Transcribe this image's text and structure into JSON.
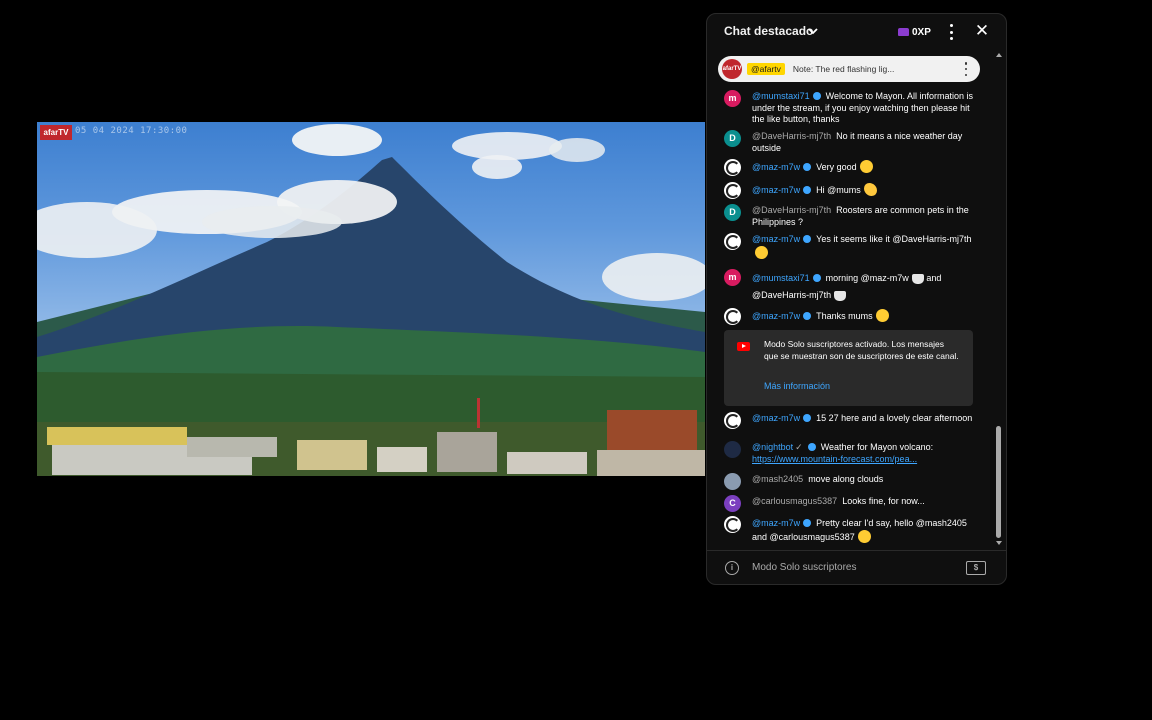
{
  "video": {
    "logo_text": "afarTV",
    "timestamp": "05 04 2024 17:30:00"
  },
  "chat": {
    "title": "Chat destacado",
    "xp_badge": "0XP",
    "pinned": {
      "author": "@afartv",
      "text": "Note: The red flashing lig..."
    },
    "messages": [
      {
        "author": "@mumstaxi71",
        "text": "Welcome to Mayon. All information is under the stream, if you enjoy watching then please hit the like button, thanks",
        "avatar": "m"
      },
      {
        "author": "@DaveHarris-mj7th",
        "text": "No it means a nice weather day outside",
        "avatar": "D"
      },
      {
        "author": "@maz-m7w",
        "text": "Very good",
        "avatar": ""
      },
      {
        "author": "@maz-m7w",
        "text": "Hi @mums",
        "avatar": ""
      },
      {
        "author": "@DaveHarris-mj7th",
        "text": "Roosters are common pets in the Philippines ?",
        "avatar": "D"
      },
      {
        "author": "@maz-m7w",
        "text": "Yes it seems like it @DaveHarris-mj7th",
        "avatar": ""
      },
      {
        "author": "@mumstaxi71",
        "text": "morning @maz-m7w",
        "text2": "and @DaveHarris-mj7th",
        "avatar": "m"
      },
      {
        "author": "@maz-m7w",
        "text": "Thanks mums",
        "avatar": ""
      },
      {
        "author": "@maz-m7w",
        "text": "15 27 here and a lovely clear afternoon",
        "avatar": ""
      },
      {
        "author": "@nightbot",
        "text": "Weather for Mayon volcano:",
        "link": "https://www.mountain-forecast.com/pea...",
        "avatar": ""
      },
      {
        "author": "@mash2405",
        "text": "move along clouds",
        "avatar": ""
      },
      {
        "author": "@carlousmagus5387",
        "text": "Looks fine, for now...",
        "avatar": "C"
      },
      {
        "author": "@maz-m7w",
        "text": "Pretty clear I'd say, hello @mash2405 and @carlousmagus5387",
        "avatar": ""
      }
    ],
    "notice": {
      "text": "Modo Solo suscriptores activado. Los mensajes que se muestran son de suscriptores de este canal.",
      "link": "Más información"
    },
    "footer": {
      "text": "Modo Solo suscriptores"
    }
  }
}
